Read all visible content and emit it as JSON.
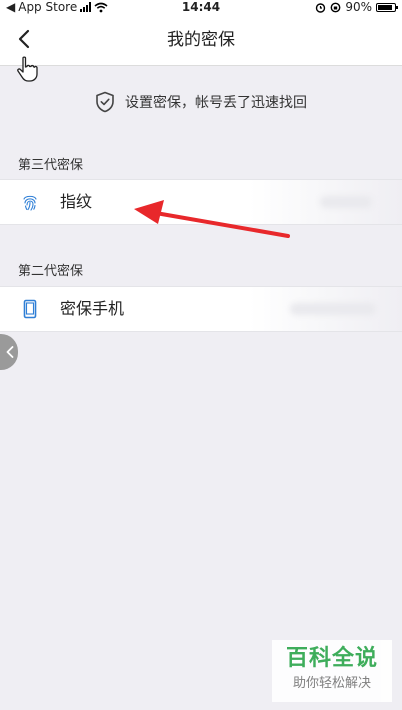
{
  "status_bar": {
    "carrier": "App Store",
    "time": "14:44",
    "battery": "90%",
    "battery_level": 0.9
  },
  "nav": {
    "title": "我的密保"
  },
  "tip": {
    "text": "设置密保，帐号丢了迅速找回"
  },
  "sections": [
    {
      "title": "第三代密保",
      "item": {
        "label": "指纹",
        "icon": "fingerprint-icon"
      }
    },
    {
      "title": "第二代密保",
      "item": {
        "label": "密保手机",
        "icon": "phone-icon"
      }
    }
  ],
  "watermark": {
    "title": "百科全说",
    "subtitle": "助你轻松解决"
  },
  "colors": {
    "background": "#efeef3",
    "annotation_arrow": "#e8282b",
    "icon_blue": "#2f7fd6",
    "watermark_green": "#2fa84f"
  }
}
